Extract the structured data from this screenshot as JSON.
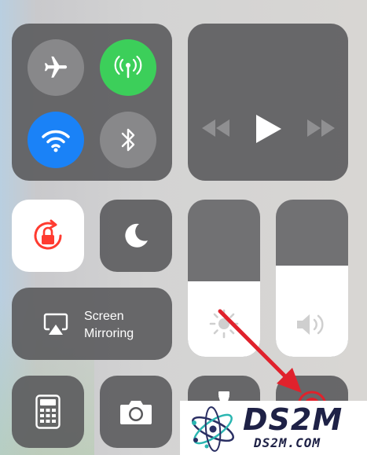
{
  "connectivity": {
    "airplane": {
      "icon": "airplane-icon",
      "color": "#8c8c8e"
    },
    "cellular": {
      "icon": "cellular-antenna-icon",
      "color": "#3ccf5a"
    },
    "wifi": {
      "icon": "wifi-icon",
      "color": "#1a82f7"
    },
    "bluetooth": {
      "icon": "bluetooth-icon",
      "color": "#8c8c8e"
    }
  },
  "media": {
    "previous_icon": "rewind-icon",
    "play_icon": "play-icon",
    "next_icon": "fast-forward-icon"
  },
  "rotation_lock": {
    "icon": "rotation-lock-icon",
    "color": "#ff3b30"
  },
  "do_not_disturb": {
    "icon": "moon-icon"
  },
  "brightness": {
    "icon": "sun-icon",
    "level": 0.48
  },
  "volume": {
    "icon": "speaker-icon",
    "level": 0.58
  },
  "screen_mirroring": {
    "line1": "Screen",
    "line2": "Mirroring",
    "icon": "airplay-icon"
  },
  "bottom_row": {
    "calculator_icon": "calculator-icon",
    "camera_icon": "camera-icon",
    "flashlight_icon": "flashlight-icon",
    "record_icon": "screen-record-icon"
  },
  "annotation": {
    "arrow_color": "#e0222c"
  },
  "watermark": {
    "title": "DS2M",
    "subtitle": "DS2M.COM"
  }
}
